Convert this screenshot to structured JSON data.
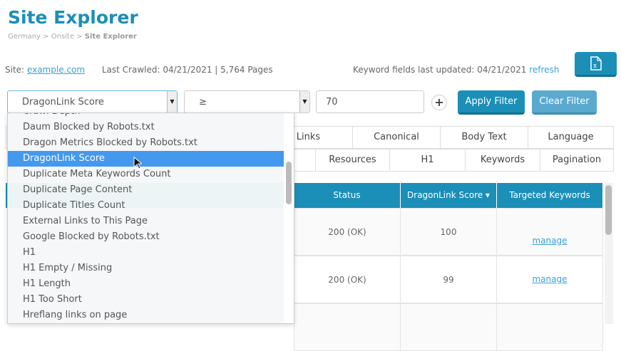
{
  "header": {
    "title": "Site Explorer",
    "breadcrumb": [
      "Germany",
      "Onsite",
      "Site Explorer"
    ],
    "sep": ">"
  },
  "site": {
    "label": "Site:",
    "domain": "example.com",
    "crawled": "Last Crawled: 04/21/2021 | 5,764 Pages"
  },
  "keywords": {
    "updated": "Keyword fields last updated: 04/21/2021",
    "refresh": "refresh"
  },
  "filter": {
    "field": "DragonLink Score",
    "operator": "≥",
    "value": "70",
    "apply": "Apply Filter",
    "clear": "Clear Filter",
    "add": "+"
  },
  "tabs_row1": [
    "Links",
    "Canonical",
    "Body Text",
    "Language"
  ],
  "tabs_row2": [
    "Resources",
    "H1",
    "Keywords",
    "Pagination"
  ],
  "table": {
    "headers": [
      "Status",
      "DragonLink Score ▾",
      "Targeted Keywords"
    ],
    "rows": [
      {
        "status": "200 (OK)",
        "score": "100",
        "kw": "manage"
      },
      {
        "status": "200 (OK)",
        "score": "99",
        "kw": "manage"
      }
    ]
  },
  "dropdown": [
    "Crawl Depth",
    "Daum Blocked by Robots.txt",
    "Dragon Metrics Blocked by Robots.txt",
    "DragonLink Score",
    "Duplicate Meta Keywords Count",
    "Duplicate Page Content",
    "Duplicate Titles Count",
    "External Links to This Page",
    "Google Blocked by Robots.txt",
    "H1",
    "H1 Empty / Missing",
    "H1 Length",
    "H1 Too Short",
    "Hreflang links on page"
  ]
}
